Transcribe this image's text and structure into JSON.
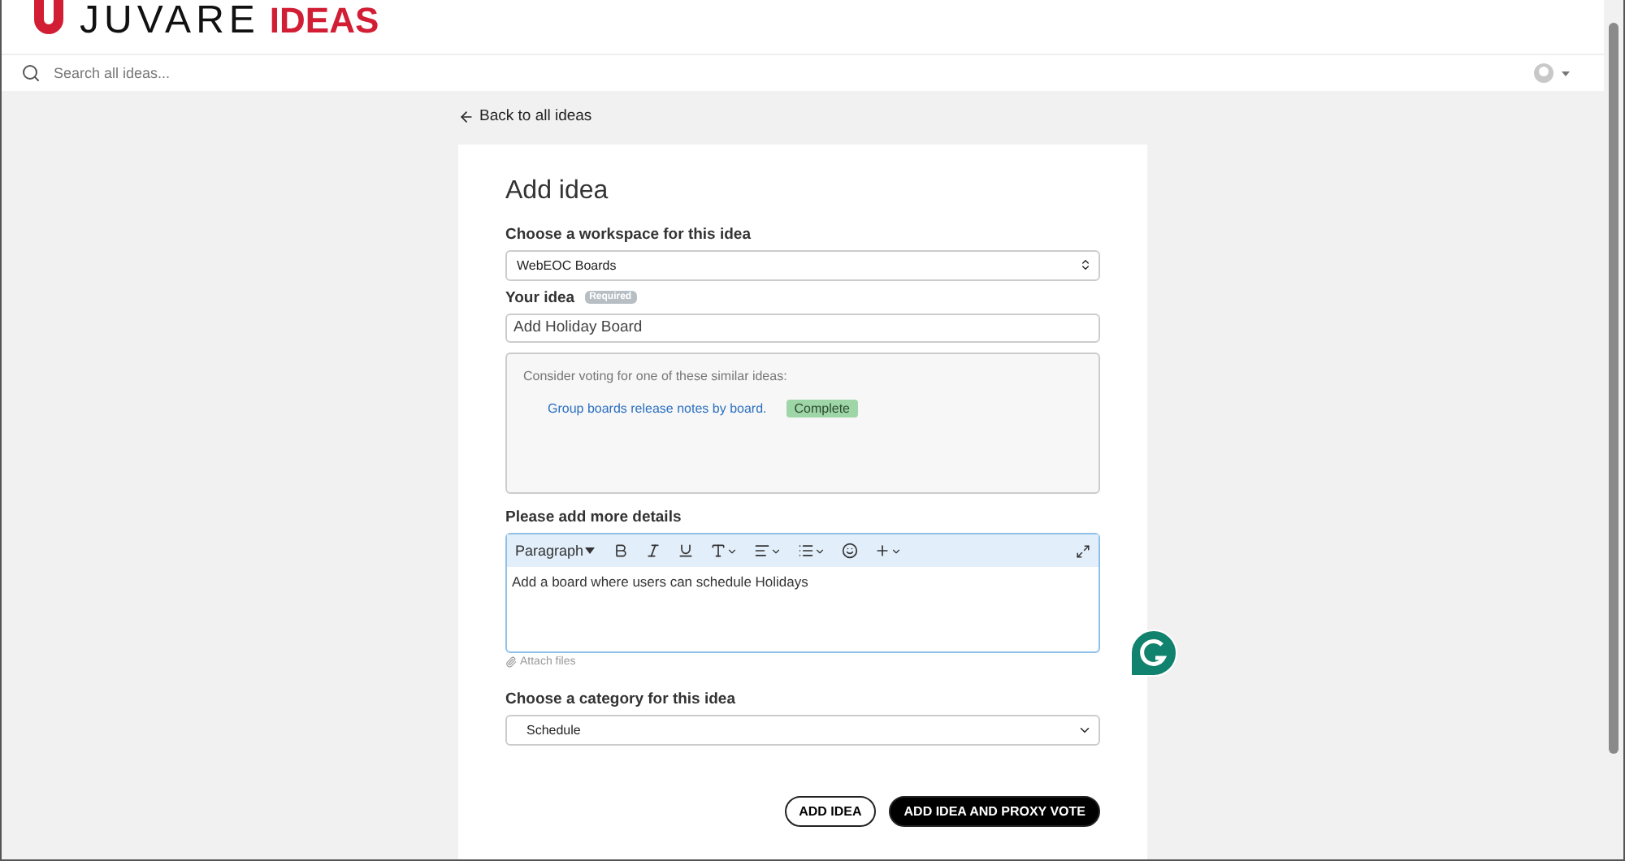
{
  "header": {
    "logo_word": "JUVARE",
    "logo_accent": "IDEAS"
  },
  "search": {
    "placeholder": "Search all ideas..."
  },
  "back_link": "Back to all ideas",
  "form": {
    "title": "Add idea",
    "workspace": {
      "label": "Choose a workspace for this idea",
      "value": "WebEOC Boards"
    },
    "idea": {
      "label": "Your idea",
      "badge": "Required",
      "value": "Add Holiday Board"
    },
    "similar": {
      "intro": "Consider voting for one of these similar ideas:",
      "items": [
        {
          "title": "Group boards release notes by board.",
          "status": "Complete",
          "color": "#9fd6a8"
        }
      ]
    },
    "details": {
      "label": "Please add more details",
      "format": "Paragraph",
      "value": "Add a board where users can schedule Holidays"
    },
    "attach": "Attach files",
    "category": {
      "label": "Choose a category for this idea",
      "value": "Schedule"
    },
    "buttons": [
      {
        "label": "ADD IDEA",
        "kind": "outline"
      },
      {
        "label": "ADD IDEA AND PROXY VOTE",
        "kind": "solid"
      }
    ]
  }
}
